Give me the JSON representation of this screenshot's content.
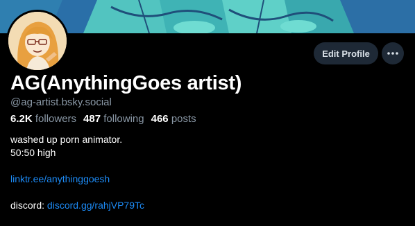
{
  "profile": {
    "display_name": "AG(AnythingGoes artist)",
    "handle": "@ag-artist.bsky.social",
    "stats": {
      "followers_count": "6.2K",
      "followers_label": "followers",
      "following_count": "487",
      "following_label": "following",
      "posts_count": "466",
      "posts_label": "posts"
    },
    "bio": {
      "line1": "washed up porn animator.",
      "line2": "50:50 high",
      "link1": "linktr.ee/anythinggoesh",
      "discord_label": "discord: ",
      "discord_link": "discord.gg/rahjVP79Tc"
    }
  },
  "actions": {
    "edit_profile_label": "Edit Profile",
    "more_icon": "ellipsis-icon"
  },
  "colors": {
    "background": "#000000",
    "button_bg": "#1e2936",
    "muted_text": "#8a98a6",
    "link": "#1d8cf8",
    "banner_teal": "#2a8f9a"
  }
}
